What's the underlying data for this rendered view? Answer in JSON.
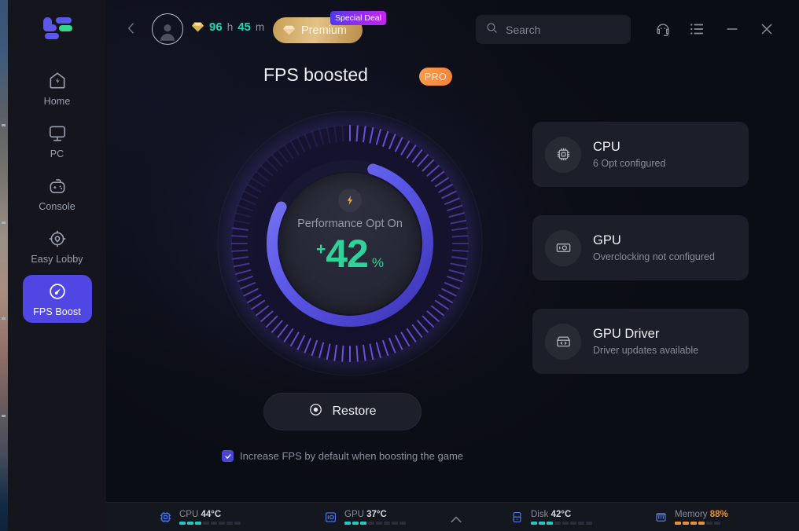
{
  "brand": {
    "logo_name": "app-logo",
    "accent": "#5046e4",
    "green": "#2fd39a"
  },
  "sidebar": {
    "items": [
      {
        "label": "Home",
        "icon": "home-bolt-icon",
        "active": false
      },
      {
        "label": "PC",
        "icon": "monitor-icon",
        "active": false
      },
      {
        "label": "Console",
        "icon": "gamepad-icon",
        "active": false
      },
      {
        "label": "Easy Lobby",
        "icon": "crosshair-icon",
        "active": false
      },
      {
        "label": "FPS Boost",
        "icon": "speedometer-icon",
        "active": true
      }
    ]
  },
  "topbar": {
    "back_icon": "chevron-left-icon",
    "avatar_icon": "user-avatar-icon",
    "time": {
      "gem_icon": "diamond-icon",
      "hours": "96",
      "hours_unit": "h",
      "minutes": "45",
      "minutes_unit": "m"
    },
    "premium": {
      "label": "Premium",
      "icon": "diamond-icon",
      "badge": "Special Deal"
    },
    "search": {
      "placeholder": "Search",
      "value": "",
      "icon": "search-icon"
    },
    "icons": [
      {
        "name": "support-headset-icon"
      },
      {
        "name": "list-menu-icon"
      },
      {
        "name": "minimize-icon"
      },
      {
        "name": "close-icon"
      }
    ]
  },
  "page": {
    "title": "FPS boosted",
    "pro_badge": "PRO"
  },
  "gauge": {
    "bolt_icon": "lightning-bolt-icon",
    "status_label": "Performance Opt On",
    "plus": "+",
    "value": "42",
    "unit": "%",
    "arc_percent": 78,
    "arc_color": "#5b57e8",
    "tick_color": "#6d4fd8"
  },
  "restore": {
    "label": "Restore",
    "icon": "restore-target-icon"
  },
  "checkbox": {
    "label": "Increase FPS by default when boosting the game",
    "checked": true
  },
  "cards": [
    {
      "title": "CPU",
      "subtitle": "6 Opt configured",
      "icon": "cpu-chip-icon"
    },
    {
      "title": "GPU",
      "subtitle": "Overclocking not configured",
      "icon": "graphics-card-icon"
    },
    {
      "title": "GPU Driver",
      "subtitle": "Driver updates available",
      "icon": "driver-box-icon"
    }
  ],
  "statusbar": {
    "expand_icon": "chevron-up-icon",
    "stats": [
      {
        "name": "CPU",
        "value": "44°C",
        "icon": "cpu-chip-icon",
        "segments_on": 3,
        "segments_total": 8,
        "warn": false
      },
      {
        "name": "GPU",
        "value": "37°C",
        "icon": "gpu-icon",
        "segments_on": 3,
        "segments_total": 8,
        "warn": false
      },
      {
        "name": "Disk",
        "value": "42°C",
        "icon": "disk-icon",
        "segments_on": 3,
        "segments_total": 8,
        "warn": false
      },
      {
        "name": "Memory",
        "value": "88%",
        "icon": "memory-ram-icon",
        "segments_on": 4,
        "segments_total": 6,
        "warn": true
      }
    ]
  }
}
